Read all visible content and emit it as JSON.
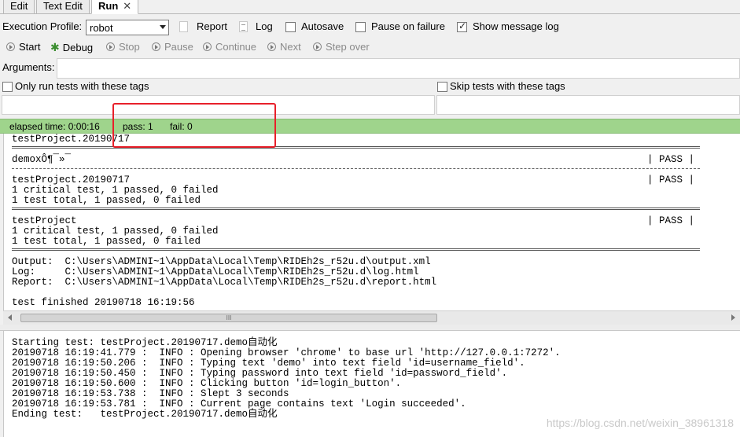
{
  "tabs": [
    {
      "label": "Edit"
    },
    {
      "label": "Text Edit"
    },
    {
      "label": "Run",
      "close": "✕"
    }
  ],
  "profile": {
    "label": "Execution Profile:",
    "value": "robot"
  },
  "options": {
    "report": "Report",
    "log": "Log",
    "autosave": "Autosave",
    "pause_on_failure": "Pause on failure",
    "show_message_log": "Show message log",
    "show_message_log_checked": true,
    "autosave_checked": false,
    "pause_on_failure_checked": false
  },
  "toolbar": {
    "start": "Start",
    "debug": "Debug",
    "stop": "Stop",
    "pause": "Pause",
    "continue": "Continue",
    "next": "Next",
    "step_over": "Step over"
  },
  "arguments": {
    "label": "Arguments:",
    "value": ""
  },
  "tags": {
    "only_run": "Only run tests with these tags",
    "skip": "Skip tests with these tags"
  },
  "status": {
    "elapsed": "elapsed time: 0:00:16",
    "pass": "pass: 1",
    "fail": "fail: 0",
    "color": "#9fd48c"
  },
  "output_lines": [
    "testProject.20190717",
    "demoxÔ¶¯»¯",
    "testProject.20190717",
    "1 critical test, 1 passed, 0 failed",
    "1 test total, 1 passed, 0 failed",
    "testProject",
    "1 critical test, 1 passed, 0 failed",
    "1 test total, 1 passed, 0 failed",
    "Output:  C:\\Users\\ADMINI~1\\AppData\\Local\\Temp\\RIDEh2s_r52u.d\\output.xml",
    "Log:     C:\\Users\\ADMINI~1\\AppData\\Local\\Temp\\RIDEh2s_r52u.d\\log.html",
    "Report:  C:\\Users\\ADMINI~1\\AppData\\Local\\Temp\\RIDEh2s_r52u.d\\report.html",
    "test finished 20190718 16:19:56"
  ],
  "pass_label": "| PASS |",
  "scroll_grip": "III",
  "log_lines": [
    "Starting test: testProject.20190717.demo自动化",
    "20190718 16:19:41.779 :  INFO : Opening browser 'chrome' to base url 'http://127.0.0.1:7272'.",
    "20190718 16:19:50.206 :  INFO : Typing text 'demo' into text field 'id=username_field'.",
    "20190718 16:19:50.450 :  INFO : Typing password into text field 'id=password_field'.",
    "20190718 16:19:50.600 :  INFO : Clicking button 'id=login_button'.",
    "20190718 16:19:53.738 :  INFO : Slept 3 seconds",
    "20190718 16:19:53.781 :  INFO : Current page contains text 'Login succeeded'.",
    "Ending test:   testProject.20190717.demo自动化"
  ],
  "watermark": "https://blog.csdn.net/weixin_38961318"
}
